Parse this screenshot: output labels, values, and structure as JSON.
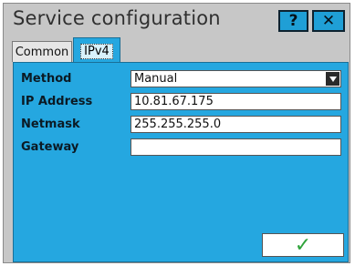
{
  "window": {
    "title": "Service configuration",
    "help_label": "?",
    "close_label": "✕"
  },
  "tabs": [
    {
      "label": "Common",
      "active": false
    },
    {
      "label": "IPv4",
      "active": true
    }
  ],
  "form": {
    "method": {
      "label": "Method",
      "value": "Manual"
    },
    "ip_address": {
      "label": "IP Address",
      "value": "10.81.67.175"
    },
    "netmask": {
      "label": "Netmask",
      "value": "255.255.255.0"
    },
    "gateway": {
      "label": "Gateway",
      "value": ""
    }
  },
  "ok_button": {
    "label": "✓",
    "icon": "checkmark-icon"
  },
  "colors": {
    "accent": "#25a7e0",
    "title_button": "#1f9fd6",
    "ok_check": "#2ea33a"
  }
}
